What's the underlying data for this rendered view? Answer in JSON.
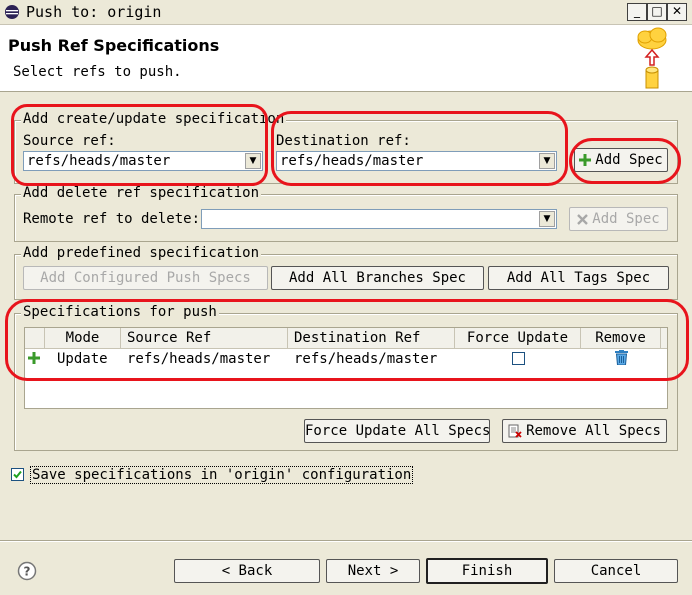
{
  "window": {
    "title": "Push to: origin",
    "controls": [
      "minimize",
      "maximize",
      "close"
    ]
  },
  "header": {
    "title": "Push Ref Specifications",
    "message": "Select refs to push."
  },
  "create_group": {
    "title": "Add create/update specification",
    "source_label": "Source ref:",
    "source_value": "refs/heads/master",
    "destination_label": "Destination ref:",
    "destination_value": "refs/heads/master",
    "add_spec_label": "Add Spec"
  },
  "delete_group": {
    "title": "Add delete ref specification",
    "remote_label": "Remote ref to delete:",
    "remote_value": "",
    "add_spec_label": "Add Spec"
  },
  "predefined_group": {
    "title": "Add predefined specification",
    "buttons": [
      "Add Configured Push Specs",
      "Add All Branches Spec",
      "Add All Tags Spec"
    ]
  },
  "specs_group": {
    "title": "Specifications for push",
    "columns": [
      "Mode",
      "Source Ref",
      "Destination Ref",
      "Force Update",
      "Remove"
    ],
    "rows": [
      {
        "mode": "Update",
        "source": "refs/heads/master",
        "destination": "refs/heads/master",
        "force": false
      }
    ],
    "force_all_label": "Force Update All Specs",
    "remove_all_label": "Remove All Specs"
  },
  "save_config": {
    "label": "Save specifications in 'origin' configuration",
    "checked": true
  },
  "footer": {
    "help": "?",
    "back_label": "< Back",
    "next_label": "Next >",
    "finish_label": "Finish",
    "cancel_label": "Cancel"
  },
  "colors": {
    "annotation": "#e8141c",
    "dialog_bg": "#ece9d8",
    "add_icon": "#3a9a2a"
  }
}
